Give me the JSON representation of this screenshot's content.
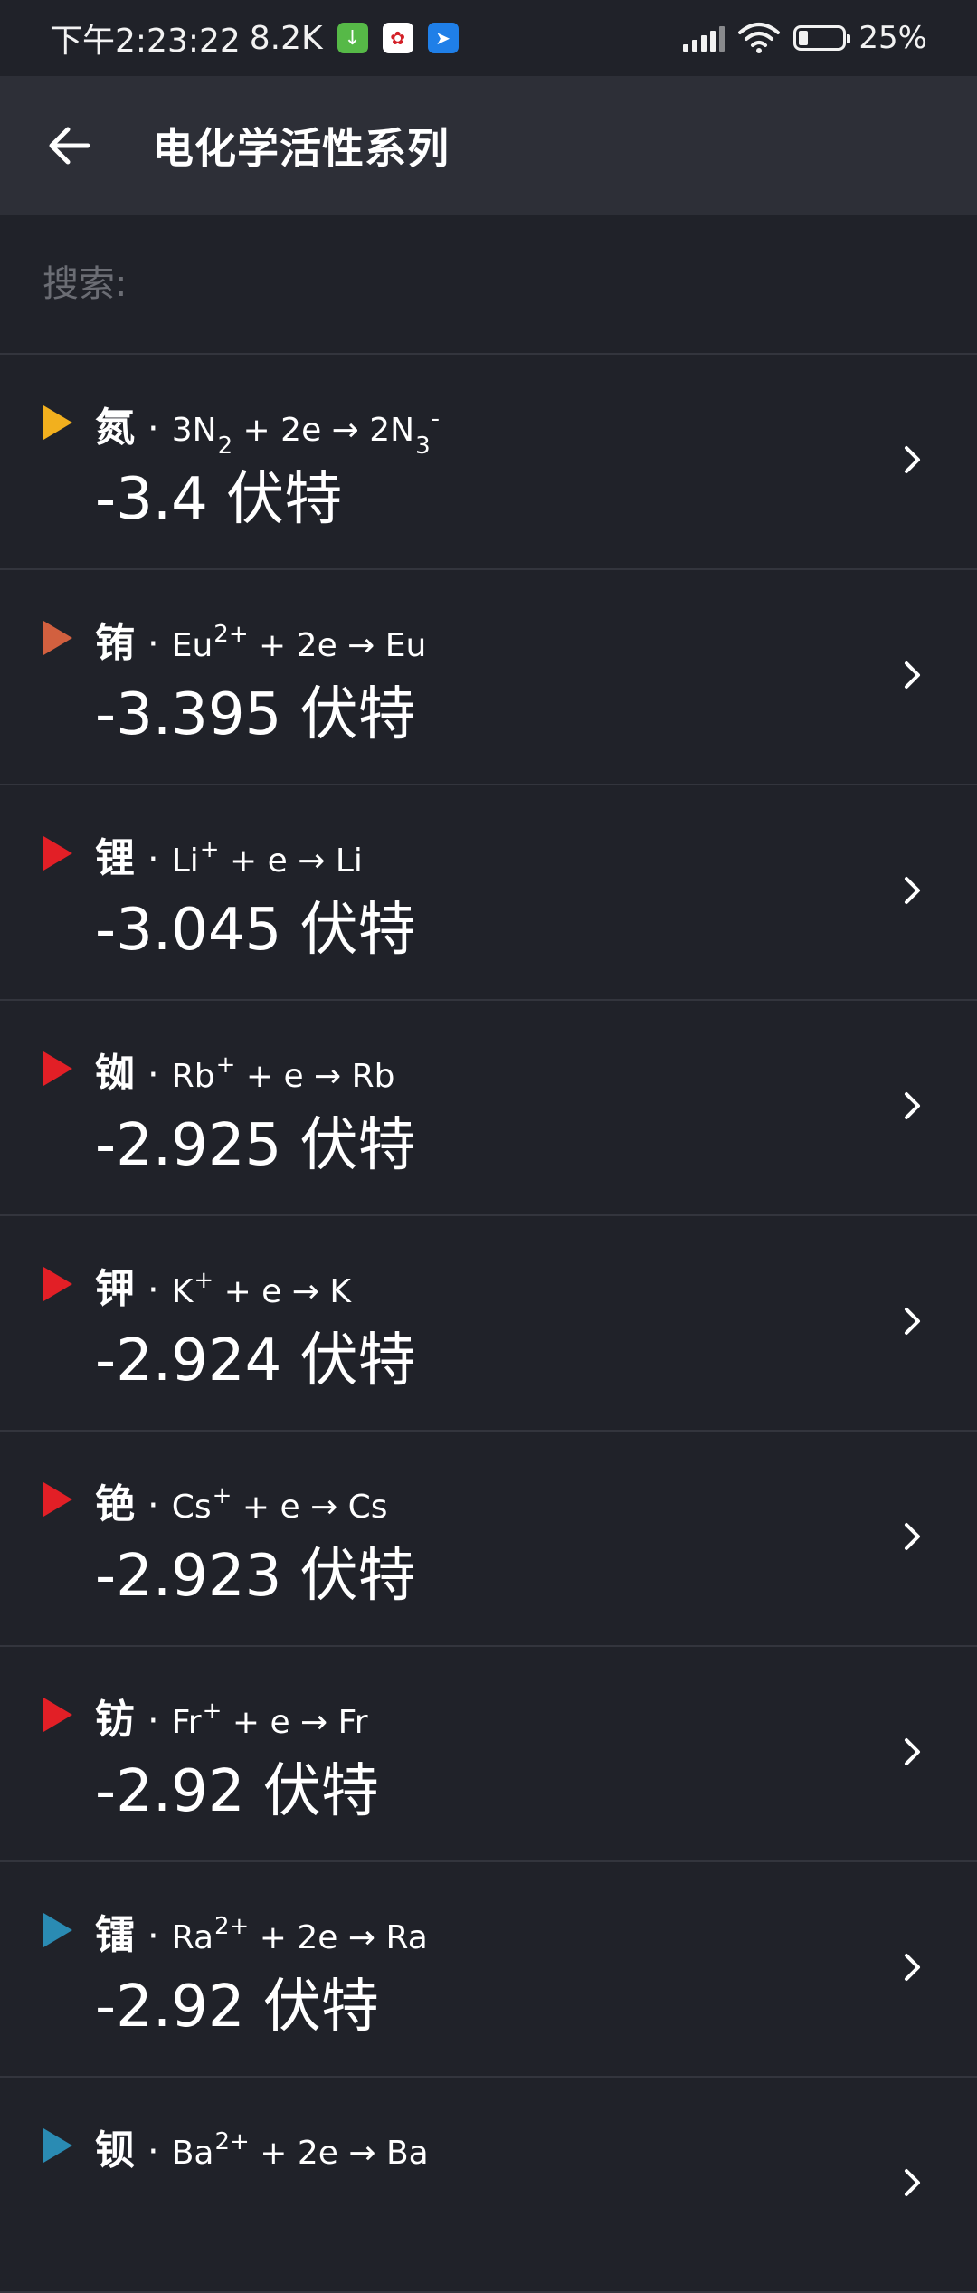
{
  "status_bar": {
    "time": "下午2:23:22",
    "speed": "8.2K",
    "battery": "25%",
    "battery_level": 0.25
  },
  "app_bar": {
    "title": "电化学活性系列"
  },
  "search": {
    "placeholder": "搜索:",
    "value": ""
  },
  "unit": "伏特",
  "items": [
    {
      "element": "氮",
      "color": "#f2b01e",
      "eq_html": "3N<sub>2</sub> + 2e → 2N<sub>3</sub><sup>-</sup>",
      "value": "-3.4 伏特"
    },
    {
      "element": "铕",
      "color": "#d2603f",
      "eq_html": "Eu<sup>2+</sup> + 2e → Eu",
      "value": "-3.395 伏特"
    },
    {
      "element": "锂",
      "color": "#e21f26",
      "eq_html": "Li<sup>+</sup> + e → Li",
      "value": "-3.045 伏特"
    },
    {
      "element": "铷",
      "color": "#e21f26",
      "eq_html": "Rb<sup>+</sup> + e → Rb",
      "value": "-2.925 伏特"
    },
    {
      "element": "钾",
      "color": "#e21f26",
      "eq_html": "K<sup>+</sup> + e → K",
      "value": "-2.924 伏特"
    },
    {
      "element": "铯",
      "color": "#e21f26",
      "eq_html": "Cs<sup>+</sup> + e → Cs",
      "value": "-2.923 伏特"
    },
    {
      "element": "钫",
      "color": "#e21f26",
      "eq_html": "Fr<sup>+</sup> + e → Fr",
      "value": "-2.92 伏特"
    },
    {
      "element": "镭",
      "color": "#2a8bb3",
      "eq_html": "Ra<sup>2+</sup> + 2e → Ra",
      "value": "-2.92 伏特"
    },
    {
      "element": "钡",
      "color": "#2a8bb3",
      "eq_html": "Ba<sup>2+</sup> + 2e → Ba",
      "value": ""
    }
  ]
}
